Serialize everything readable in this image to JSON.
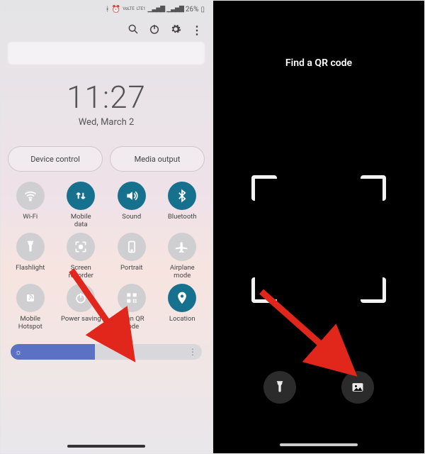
{
  "left": {
    "status": {
      "lte1": "VoLTE",
      "lte2": "LTE1",
      "battery": "26%"
    },
    "clock": {
      "time": "11:27",
      "date": "Wed, March 2"
    },
    "pills": {
      "device_control": "Device control",
      "media_output": "Media output"
    },
    "tiles": [
      {
        "key": "wifi",
        "label": "Wi-Fi",
        "on": false
      },
      {
        "key": "mobile-data",
        "label": "Mobile\ndata",
        "on": true
      },
      {
        "key": "sound",
        "label": "Sound",
        "on": true
      },
      {
        "key": "bluetooth",
        "label": "Bluetooth",
        "on": true
      },
      {
        "key": "flashlight",
        "label": "Flashlight",
        "on": false
      },
      {
        "key": "screen-recorder",
        "label": "Screen\nrecorder",
        "on": false
      },
      {
        "key": "portrait",
        "label": "Portrait",
        "on": false
      },
      {
        "key": "airplane",
        "label": "Airplane\nmode",
        "on": false
      },
      {
        "key": "hotspot",
        "label": "Mobile\nHotspot",
        "on": false
      },
      {
        "key": "power-saving",
        "label": "Power saving",
        "on": false
      },
      {
        "key": "scan-qr",
        "label": "Scan QR\ncode",
        "on": false
      },
      {
        "key": "location",
        "label": "Location",
        "on": true
      }
    ],
    "pager": "• • • • •",
    "brightness_pct": 44
  },
  "right": {
    "title": "Find a QR code"
  }
}
